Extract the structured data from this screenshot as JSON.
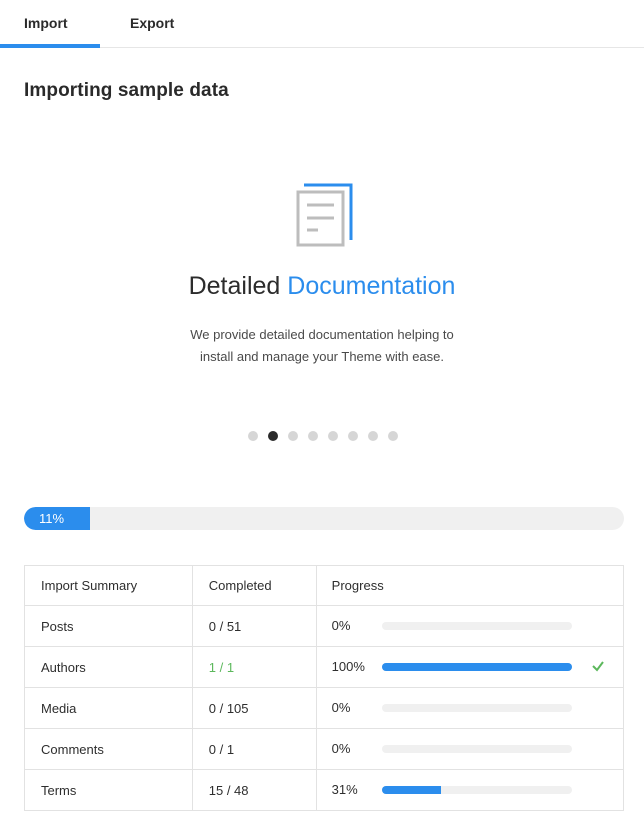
{
  "tabs": [
    {
      "label": "Import",
      "active": true
    },
    {
      "label": "Export",
      "active": false
    }
  ],
  "page_title": "Importing sample data",
  "slide": {
    "icon": "document-icon",
    "heading_plain": "Detailed",
    "heading_accent": "Documentation",
    "description": "We provide detailed documentation helping to install and manage your Theme with ease.",
    "dot_count": 8,
    "active_dot": 1
  },
  "overall_progress": {
    "percent": 11,
    "label": "11%"
  },
  "table": {
    "headers": [
      "Import Summary",
      "Completed",
      "Progress"
    ],
    "rows": [
      {
        "name": "Posts",
        "completed": "0 / 51",
        "progress_label": "0%",
        "progress": 0,
        "done": false
      },
      {
        "name": "Authors",
        "completed": "1 / 1",
        "progress_label": "100%",
        "progress": 100,
        "done": true
      },
      {
        "name": "Media",
        "completed": "0 / 105",
        "progress_label": "0%",
        "progress": 0,
        "done": false
      },
      {
        "name": "Comments",
        "completed": "0 / 1",
        "progress_label": "0%",
        "progress": 0,
        "done": false
      },
      {
        "name": "Terms",
        "completed": "15 / 48",
        "progress_label": "31%",
        "progress": 31,
        "done": false
      }
    ]
  },
  "colors": {
    "accent": "#2b8ded",
    "success": "#5cb85c",
    "track": "#f0f0f0"
  }
}
